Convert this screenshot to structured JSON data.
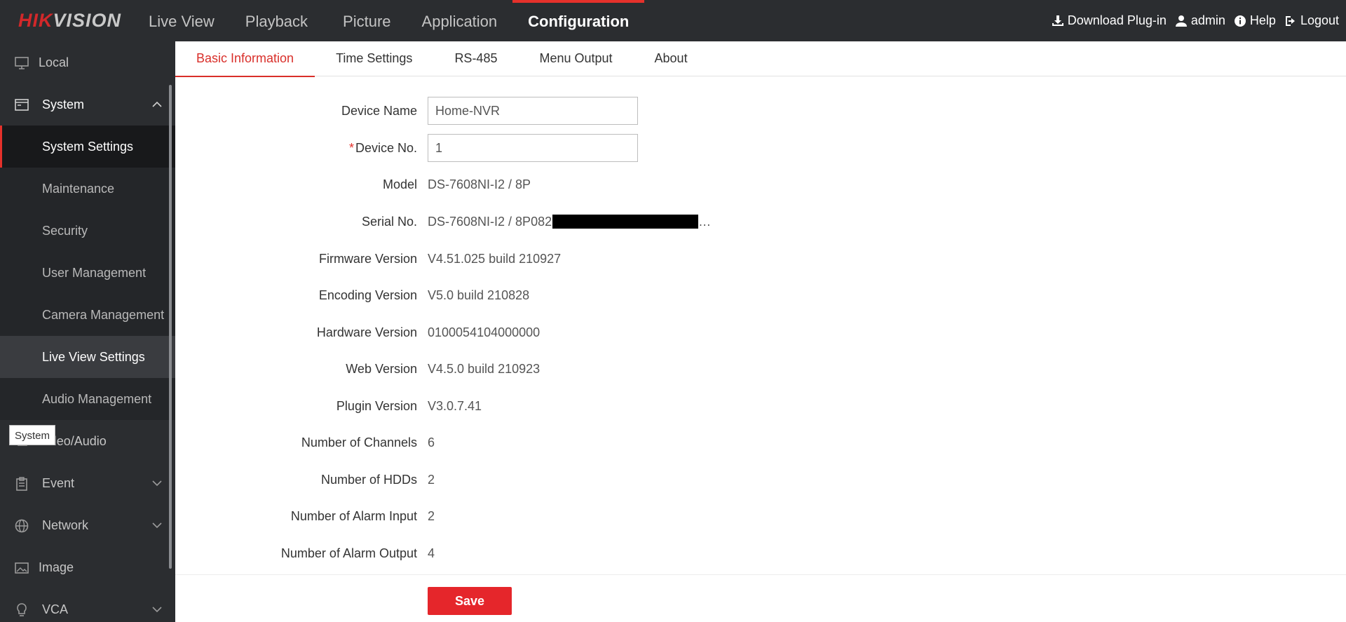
{
  "brand": {
    "logo_part1": "HIK",
    "logo_part2": "VISION"
  },
  "nav": {
    "items": [
      "Live View",
      "Playback",
      "Picture",
      "Application",
      "Configuration"
    ],
    "active": "Configuration"
  },
  "header_right": {
    "download": "Download Plug-in",
    "user": "admin",
    "help": "Help",
    "logout": "Logout"
  },
  "sidebar": {
    "local": "Local",
    "system": "System",
    "system_settings": "System Settings",
    "maintenance": "Maintenance",
    "security": "Security",
    "user_management": "User Management",
    "camera_management": "Camera Management",
    "live_view_settings": "Live View Settings",
    "audio_management": "Audio Management",
    "video_audio": "Video/Audio",
    "event": "Event",
    "network": "Network",
    "image": "Image",
    "vca": "VCA",
    "tooltip": "System"
  },
  "tabs": [
    "Basic Information",
    "Time Settings",
    "RS-485",
    "Menu Output",
    "About"
  ],
  "form": {
    "device_name": {
      "label": "Device Name",
      "value": "Home-NVR"
    },
    "device_no": {
      "label": "Device No.",
      "required_mark": "*",
      "value": "1"
    },
    "model": {
      "label": "Model",
      "value": "DS-7608NI-I2 / 8P"
    },
    "serial_no": {
      "label": "Serial No.",
      "value": "DS-7608NI-I2 / 8P082",
      "ellipsis": "…"
    },
    "firmware": {
      "label": "Firmware Version",
      "value": "V4.51.025 build 210927"
    },
    "encoding": {
      "label": "Encoding Version",
      "value": "V5.0 build 210828"
    },
    "hardware": {
      "label": "Hardware Version",
      "value": "0100054104000000"
    },
    "web": {
      "label": "Web Version",
      "value": "V4.5.0 build 210923"
    },
    "plugin": {
      "label": "Plugin Version",
      "value": "V3.0.7.41"
    },
    "channels": {
      "label": "Number of Channels",
      "value": "6"
    },
    "hdds": {
      "label": "Number of HDDs",
      "value": "2"
    },
    "alarm_in": {
      "label": "Number of Alarm Input",
      "value": "2"
    },
    "alarm_out": {
      "label": "Number of Alarm Output",
      "value": "4"
    }
  },
  "save_label": "Save",
  "colors": {
    "accent": "#e5312b",
    "topbar": "#2b2d30",
    "sidebar_selected": "#18191b"
  }
}
